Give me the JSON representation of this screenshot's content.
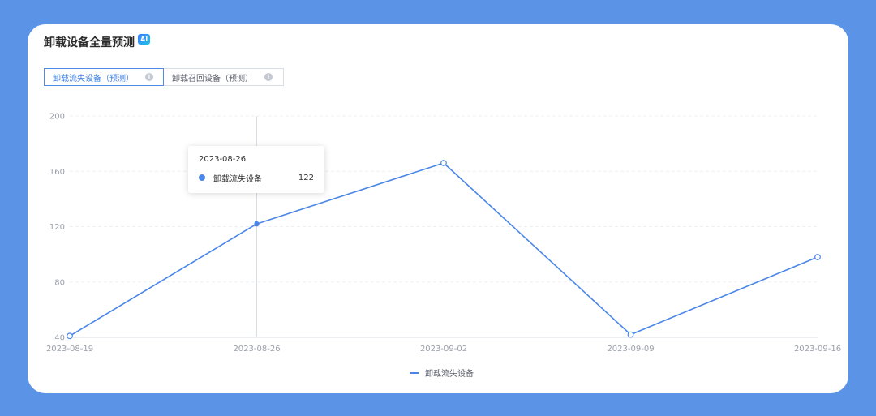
{
  "header": {
    "title": "卸载设备全量预测",
    "badge": "AI"
  },
  "tabs": [
    {
      "label": "卸载流失设备（预测）",
      "active": true
    },
    {
      "label": "卸载召回设备（预测）",
      "active": false
    }
  ],
  "tooltip": {
    "date": "2023-08-26",
    "series": "卸载流失设备",
    "value": "122"
  },
  "colors": {
    "background": "#5b94e6",
    "line": "#4a86e8",
    "active_tab": "#3f7fe6"
  },
  "chart_data": {
    "type": "line",
    "x": [
      "2023-08-19",
      "2023-08-26",
      "2023-09-02",
      "2023-09-09",
      "2023-09-16"
    ],
    "series": [
      {
        "name": "卸载流失设备",
        "values": [
          41,
          122,
          166,
          42,
          98
        ]
      }
    ],
    "y_ticks": [
      40,
      80,
      120,
      160,
      200
    ],
    "ylim": [
      40,
      200
    ],
    "grid": true,
    "legend": "bottom-center",
    "highlight_index": 1
  }
}
